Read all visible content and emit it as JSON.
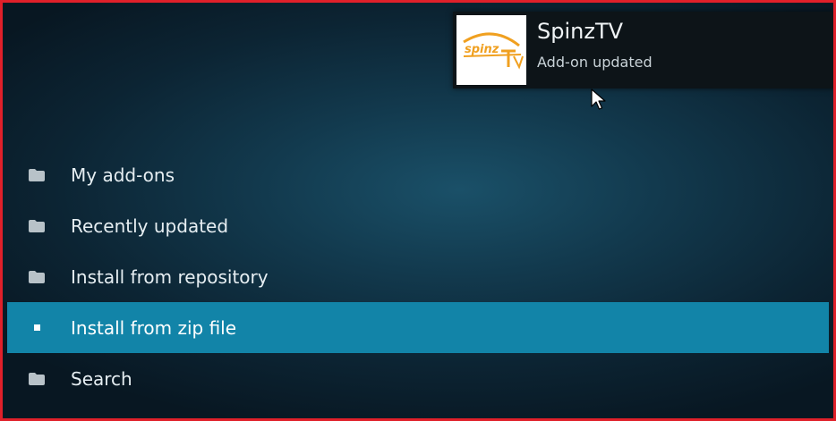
{
  "menu": {
    "items": [
      {
        "label": "My add-ons",
        "icon": "folder-icon",
        "focused": false
      },
      {
        "label": "Recently updated",
        "icon": "folder-icon",
        "focused": false
      },
      {
        "label": "Install from repository",
        "icon": "folder-icon",
        "focused": false
      },
      {
        "label": "Install from zip file",
        "icon": "square-icon",
        "focused": true
      },
      {
        "label": "Search",
        "icon": "folder-icon",
        "focused": false
      }
    ]
  },
  "notification": {
    "title": "SpinzTV",
    "message": "Add-on updated",
    "thumbnail_logo_text": "spinz"
  },
  "colors": {
    "frame_border": "#e0202a",
    "focus_highlight": "#1284a8",
    "logo_orange": "#f0a020"
  }
}
